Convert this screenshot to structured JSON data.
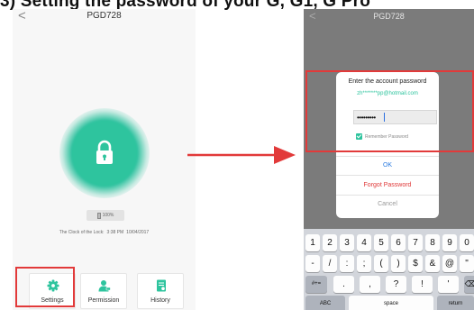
{
  "banner": {
    "text": "3) Setting the password of your G, G1, G Pro"
  },
  "left_screen": {
    "back_glyph": "<",
    "title": "PGD728",
    "battery_text": "100%",
    "clock": {
      "prefix": "The Clock of the Lock:",
      "time": "3:38 PM",
      "date": "10/04/2017"
    },
    "buttons": [
      {
        "label": "Settings",
        "icon": "gear-icon"
      },
      {
        "label": "Permission",
        "icon": "person-icon"
      },
      {
        "label": "History",
        "icon": "document-icon"
      }
    ],
    "accent_color": "#2ec49e"
  },
  "annotations": {
    "highlight_color": "#e23a3a",
    "arrow_color": "#e23a3a"
  },
  "right_screen": {
    "back_glyph": "<",
    "title": "PGD728",
    "dimmed_battery": "100%",
    "dialog": {
      "title": "Enter the account password",
      "account": "zh*******pp@hotmail.com",
      "password_mask": "•••••••••",
      "remember_label": "Remember Password",
      "remember_checked": true,
      "ok_label": "OK",
      "forgot_label": "Forgot Password",
      "cancel_label": "Cancel"
    },
    "keyboard": {
      "row1": [
        "1",
        "2",
        "3",
        "4",
        "5",
        "6",
        "7",
        "8",
        "9",
        "0"
      ],
      "row2": [
        "-",
        "/",
        ":",
        ";",
        "(",
        ")",
        "$",
        "&",
        "@",
        "\""
      ],
      "row3": {
        "mode": "#+=",
        "keys": [
          ".",
          ",",
          "?",
          "!",
          "'"
        ],
        "backspace": "⌫"
      },
      "row4": {
        "abc": "ABC",
        "space": "space",
        "return": "return"
      }
    }
  }
}
